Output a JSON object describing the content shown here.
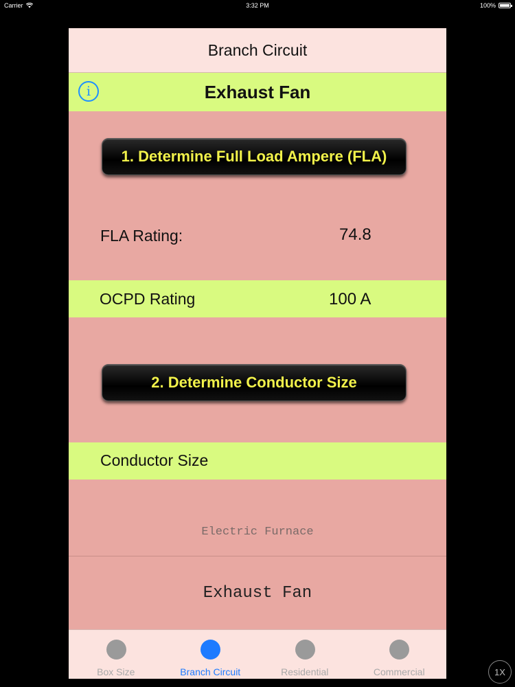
{
  "status_bar": {
    "carrier": "Carrier",
    "time": "3:32 PM",
    "battery": "100%"
  },
  "navbar": {
    "title": "Branch Circuit"
  },
  "header": {
    "title": "Exhaust Fan",
    "info_icon": "info-icon"
  },
  "step1": {
    "label": "1. Determine Full Load Ampere (FLA)"
  },
  "fla": {
    "label": "FLA Rating:",
    "value": "74.8"
  },
  "ocpd": {
    "label": "OCPD Rating",
    "value": "100 A"
  },
  "step2": {
    "label": "2. Determine Conductor Size"
  },
  "conductor": {
    "label": "Conductor Size"
  },
  "picker": {
    "items": [
      "Electric Furnace",
      "Exhaust Fan"
    ],
    "selected": "Exhaust Fan"
  },
  "tabs": [
    {
      "label": "Box Size",
      "active": false
    },
    {
      "label": "Branch Circuit",
      "active": true
    },
    {
      "label": "Residential",
      "active": false
    },
    {
      "label": "Commercial",
      "active": false
    }
  ],
  "zoom": {
    "label": "1X"
  },
  "colors": {
    "accent": "#1e7bff",
    "green_bar": "#d9fa80",
    "body_background": "#e8a8a2",
    "button_text": "#f2f24a"
  }
}
